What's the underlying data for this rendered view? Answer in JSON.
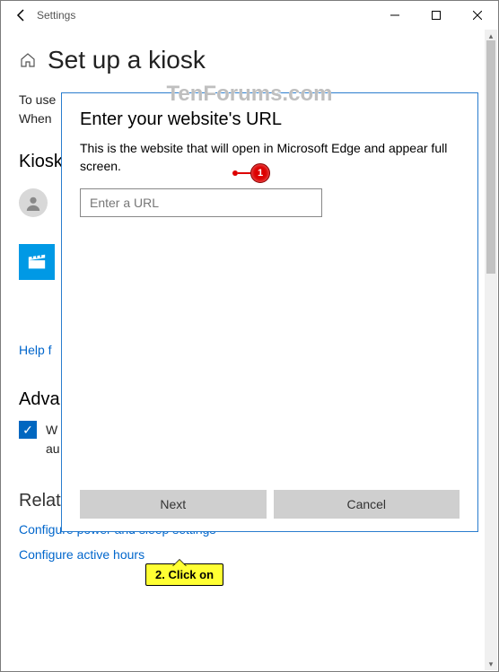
{
  "window": {
    "title": "Settings",
    "controls": {
      "min": "–",
      "max": "▢",
      "close": "✕"
    }
  },
  "page": {
    "title": "Set up a kiosk",
    "intro_line1": "To use",
    "intro_line2": "When",
    "section_kiosk": "Kiosk",
    "help_link": "Help f",
    "advanced_heading": "Adva",
    "checkbox_line1": "W",
    "checkbox_line2": "au",
    "related_heading": "Related setti",
    "related_link1": "Configure power and sleep settings",
    "related_link2": "Configure active hours"
  },
  "dialog": {
    "title": "Enter your website's URL",
    "description": "This is the website that will open in Microsoft Edge and appear full screen.",
    "placeholder": "Enter a URL",
    "next": "Next",
    "cancel": "Cancel"
  },
  "watermark": "TenForums.com",
  "annotations": {
    "step1": "1",
    "step2": "2. Click on"
  }
}
